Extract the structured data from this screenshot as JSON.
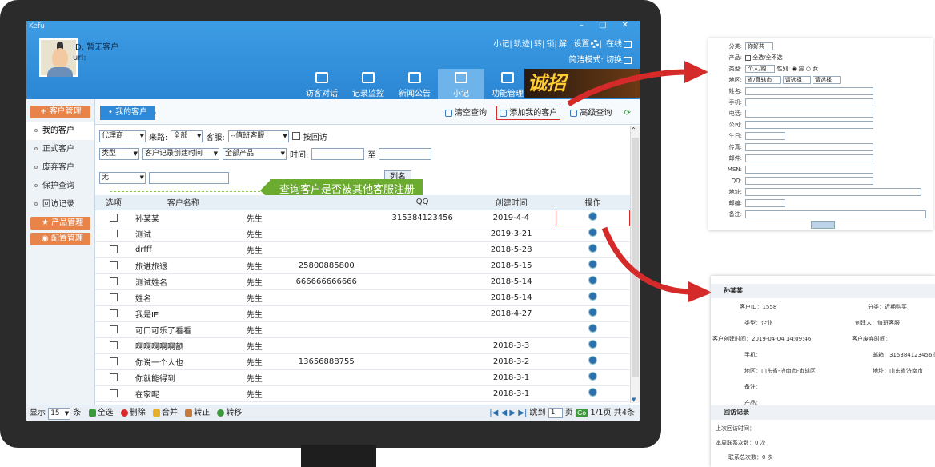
{
  "app": {
    "name": "Kefu"
  },
  "header": {
    "id_label": "ID: 暂无客户",
    "url_label": "url:",
    "links": [
      "小记",
      "轨迹",
      "转",
      "锁",
      "解"
    ],
    "settings": "设置",
    "online": "在线",
    "mode": "简洁模式: 切换",
    "banner": "诚招"
  },
  "nav": {
    "tabs": [
      "访客对话",
      "记录监控",
      "新闻公告",
      "小记",
      "功能管理"
    ]
  },
  "sidebar": {
    "customer_mgmt": "客户管理",
    "items": [
      "我的客户",
      "正式客户",
      "废弃客户",
      "保护查询",
      "回访记录"
    ],
    "product_mgmt": "产品管理",
    "config_mgmt": "配置管理"
  },
  "main": {
    "crumb": "我的客户",
    "actions": {
      "clear": "清空查询",
      "add": "添加我的客户",
      "advanced": "高级查询"
    },
    "filters": {
      "agent": "代理商",
      "source_label": "来路:",
      "source": "全部",
      "service_label": "客服:",
      "service": "--值班客服",
      "revisit": "按回访",
      "type": "类型",
      "time_field": "客户记录创建时间",
      "product": "全部产品",
      "time_label": "时间:",
      "to": "至"
    },
    "search": {
      "field": "无",
      "col_button": "列名"
    },
    "callout": "查询客户是否被其他客服注册"
  },
  "table": {
    "headers": [
      "选项",
      "客户名称",
      "",
      "",
      "QQ",
      "创建时间",
      "操作"
    ],
    "rows": [
      {
        "name": "孙某某",
        "title": "先生",
        "phone": "",
        "qq": "315384123456",
        "date": "2019-4-4"
      },
      {
        "name": "测试",
        "title": "先生",
        "phone": "",
        "qq": "",
        "date": "2019-3-21"
      },
      {
        "name": "drfff",
        "title": "先生",
        "phone": "",
        "qq": "",
        "date": "2018-5-28"
      },
      {
        "name": "旅进旅退",
        "title": "先生",
        "phone": "25800885800",
        "qq": "",
        "date": "2018-5-15"
      },
      {
        "name": "测试姓名",
        "title": "先生",
        "phone": "666666666666",
        "qq": "",
        "date": "2018-5-14"
      },
      {
        "name": "姓名",
        "title": "先生",
        "phone": "",
        "qq": "",
        "date": "2018-5-14"
      },
      {
        "name": "我是IE",
        "title": "先生",
        "phone": "",
        "qq": "",
        "date": "2018-4-27"
      },
      {
        "name": "可口可乐了看看",
        "title": "先生",
        "phone": "",
        "qq": "",
        "date": ""
      },
      {
        "name": "啊啊啊啊啊额",
        "title": "先生",
        "phone": "",
        "qq": "",
        "date": "2018-3-3"
      },
      {
        "name": "你说一个人也",
        "title": "先生",
        "phone": "13656888755",
        "qq": "",
        "date": "2018-3-2"
      },
      {
        "name": "你就能得到",
        "title": "先生",
        "phone": "",
        "qq": "",
        "date": "2018-3-1"
      },
      {
        "name": "在家呢",
        "title": "先生",
        "phone": "",
        "qq": "",
        "date": "2018-3-1"
      }
    ]
  },
  "footer": {
    "show": "显示",
    "per_page": "15",
    "unit": "条",
    "select_all": "全选",
    "delete": "删除",
    "merge": "合并",
    "convert": "转正",
    "transfer": "转移",
    "jump": "跳到",
    "page_input": "1",
    "page_unit": "页",
    "page_info": "1/1页 共4条",
    "go": "Go"
  },
  "form_panel": {
    "labels": [
      "分类:",
      "产品:",
      "类型:",
      "地区:",
      "姓名:",
      "手机:",
      "电话:",
      "公司:",
      "生日:",
      "传真:",
      "邮件:",
      "MSN:",
      "QQ:",
      "地址:",
      "邮编:",
      "备注:"
    ],
    "category": "你好共",
    "product": "全选/全不选",
    "type": "个人/购",
    "gender_label": "性别:",
    "male": "男",
    "female": "女",
    "region": "省/直辖市",
    "region2": "请选择",
    "region3": "请选择"
  },
  "detail_panel": {
    "name": "孙某某",
    "rows": [
      [
        "客户ID：1558",
        "分类：近期购买"
      ],
      [
        "类型：企业",
        "创建人：值班客服"
      ],
      [
        "客户创建时间：2019-04-04 14:09:46",
        "客户废弃时间："
      ],
      [
        "手机：",
        "邮箱：315384123456@qq"
      ],
      [
        "地区：山东省-济南市-市辖区",
        "地址：山东省济南市"
      ],
      [
        "备注：",
        ""
      ],
      [
        "产品：",
        ""
      ]
    ],
    "visit_head": "回访记录",
    "visit_rows": [
      "上次回访时间：",
      "本周联系次数：0 次",
      "联系总次数：0 次"
    ]
  },
  "colors": {
    "accent": "#2e8ad8",
    "orange": "#e8834a",
    "green": "#6bab2f",
    "red": "#d42a2a"
  }
}
